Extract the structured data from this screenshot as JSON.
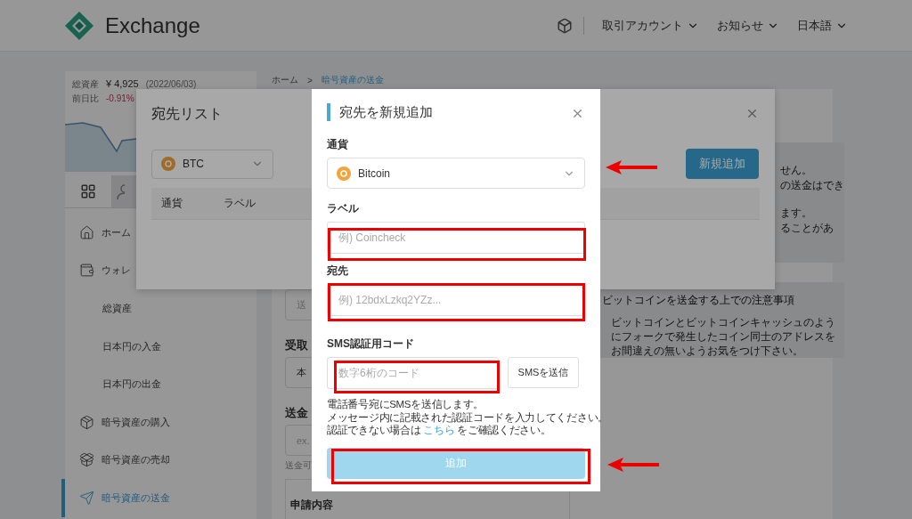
{
  "header": {
    "brand": "Exchange",
    "menus": [
      {
        "label": "取引アカウント"
      },
      {
        "label": "お知らせ"
      },
      {
        "label": "日本語"
      }
    ]
  },
  "sidebar": {
    "summary": {
      "total_label": "総資産",
      "total_value": "¥ 4,925",
      "date": "(2022/06/03)",
      "change_label": "前日比",
      "change_value": "-0.91%"
    },
    "tabs": [
      {
        "selected": true
      },
      {
        "selected": false
      }
    ],
    "items": [
      {
        "kind": "main",
        "label": "ホーム",
        "selected": false
      },
      {
        "kind": "main",
        "label": "ウォレ",
        "selected": false
      },
      {
        "kind": "sub",
        "label": "総資産",
        "selected": false
      },
      {
        "kind": "sub",
        "label": "日本円の入金",
        "selected": false
      },
      {
        "kind": "sub",
        "label": "日本円の出金",
        "selected": false
      },
      {
        "kind": "main",
        "label": "暗号資産の購入",
        "selected": false
      },
      {
        "kind": "main",
        "label": "暗号資産の売却",
        "selected": false
      },
      {
        "kind": "main",
        "label": "暗号資産の送金",
        "selected": true
      }
    ]
  },
  "breadcrumb": {
    "items": [
      "ホーム",
      "暗号資産の送金"
    ],
    "separator": ">"
  },
  "form": {
    "field_1": "送",
    "recipient_label": "受取",
    "recipient_value": "本",
    "amount_label": "送金",
    "amount_placeholder": "ex.",
    "amount_note": "送金可",
    "summary_title": "申請内容"
  },
  "notices": [
    {
      "lines": [
        "せん。",
        "の送金はでき",
        "ます。",
        "ることがあ"
      ]
    },
    {
      "title": "ビットコインを送金する上での注意事項",
      "body": "ビットコインとビットコインキャッシュのようにフォークで発生したコイン同士のアドレスをお間違えの無いようお気をつけ下さい。"
    }
  ],
  "address_list": {
    "title": "宛先リスト",
    "currency": "BTC",
    "add_button": "新規追加",
    "columns": [
      "通貨",
      "ラベル"
    ]
  },
  "modal": {
    "title": "宛先を新規追加",
    "currency_label": "通貨",
    "currency": "Bitcoin",
    "label_label": "ラベル",
    "label_placeholder": "例) Coincheck",
    "address_label": "宛先",
    "address_placeholder": "例) 12bdxLzkq2YZz...",
    "sms_label": "SMS認証用コード",
    "sms_placeholder": "数字6桁のコード",
    "sms_button": "SMSを送信",
    "help_lines": [
      "電話番号宛にSMSを送信します。",
      "メッセージ内に記載された認証コードを入力してください。"
    ],
    "help_link_line": {
      "before": "認証できない場合は ",
      "link": "こちら",
      "after": " をご確認ください。"
    },
    "submit": "追加"
  }
}
